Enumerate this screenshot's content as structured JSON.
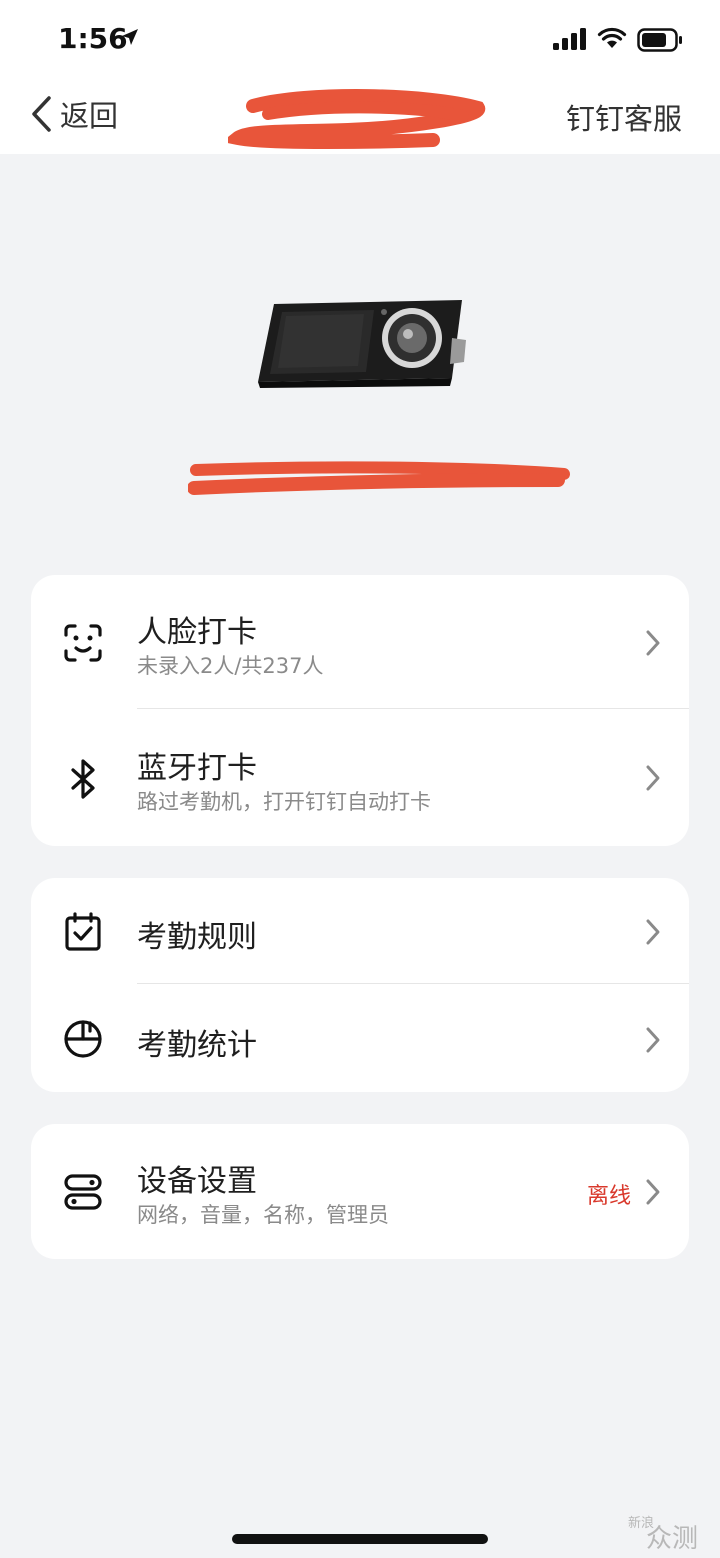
{
  "status_bar": {
    "time": "1:56"
  },
  "nav": {
    "back_label": "返回",
    "title": "",
    "service_label": "钉钉客服"
  },
  "device": {
    "name": ""
  },
  "cards": [
    {
      "rows": [
        {
          "icon": "face-scan-icon",
          "title": "人脸打卡",
          "subtitle": "未录入2人/共237人"
        },
        {
          "icon": "bluetooth-icon",
          "title": "蓝牙打卡",
          "subtitle": "路过考勤机，打开钉钉自动打卡"
        }
      ]
    },
    {
      "rows": [
        {
          "icon": "calendar-check-icon",
          "title": "考勤规则"
        },
        {
          "icon": "pie-chart-icon",
          "title": "考勤统计"
        }
      ]
    },
    {
      "rows": [
        {
          "icon": "device-toggle-icon",
          "title": "设备设置",
          "subtitle": "网络，音量，名称，管理员",
          "status": "离线"
        }
      ]
    }
  ],
  "colors": {
    "background": "#f2f3f5",
    "offline_status": "#d9382b",
    "redaction": "#e8553a"
  },
  "watermark": {
    "small": "新浪",
    "big": "众测"
  }
}
